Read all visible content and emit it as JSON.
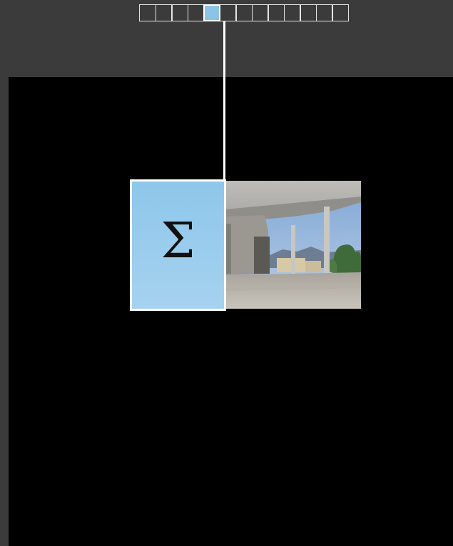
{
  "frame_strip": {
    "cells": 13,
    "active_index": 4,
    "active_color": "#8cc4e6",
    "border_color": "#e6e6e6"
  },
  "aggregation": {
    "symbol": "Σ",
    "icon": "sigma-icon",
    "color": "#8ec7ea"
  },
  "photo": {
    "icon": "building-photo"
  },
  "colors": {
    "background": "#3b3b3b",
    "canvas": "#000000",
    "connector": "#ffffff"
  }
}
